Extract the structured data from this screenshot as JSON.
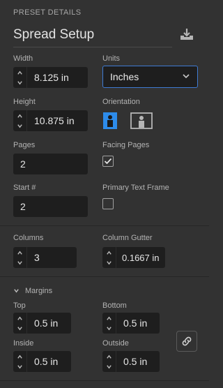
{
  "panel": {
    "section_title": "PRESET DETAILS",
    "preset_name": "Spread Setup",
    "save_preset_icon": "save-preset-icon"
  },
  "width": {
    "label": "Width",
    "value": "8.125 in"
  },
  "units": {
    "label": "Units",
    "value": "Inches"
  },
  "height": {
    "label": "Height",
    "value": "10.875 in"
  },
  "orientation": {
    "label": "Orientation",
    "selected": "portrait"
  },
  "pages": {
    "label": "Pages",
    "value": "2"
  },
  "facing_pages": {
    "label": "Facing Pages",
    "checked": true
  },
  "start_number": {
    "label": "Start #",
    "value": "2"
  },
  "primary_text_frame": {
    "label": "Primary Text Frame",
    "checked": false
  },
  "columns": {
    "label": "Columns",
    "value": "3"
  },
  "column_gutter": {
    "label": "Column Gutter",
    "value": "0.1667 in"
  },
  "margins": {
    "label": "Margins",
    "expanded": true,
    "top": {
      "label": "Top",
      "value": "0.5 in"
    },
    "bottom": {
      "label": "Bottom",
      "value": "0.5 in"
    },
    "inside": {
      "label": "Inside",
      "value": "0.5 in"
    },
    "outside": {
      "label": "Outside",
      "value": "0.5 in"
    },
    "link_icon": "link-icon"
  },
  "colors": {
    "background": "#323232",
    "field_bg": "#1e1e1e",
    "accent": "#3f7bd3",
    "orientation_selected": "#2d8ceb"
  }
}
